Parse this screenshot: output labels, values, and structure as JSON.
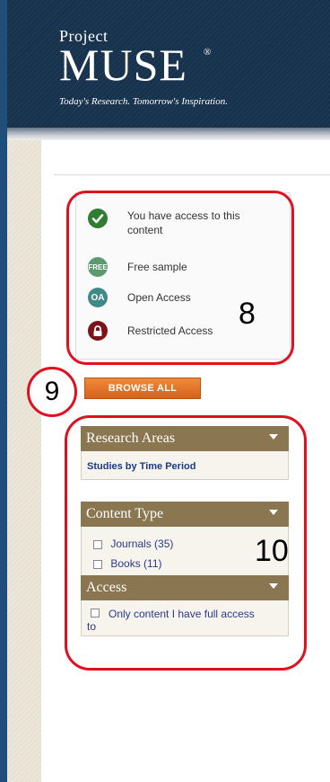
{
  "header": {
    "logo_project": "Project",
    "logo_muse": "MUSE",
    "logo_reg": "®",
    "tagline": "Today's Research. Tomorrow's Inspiration."
  },
  "legend": {
    "items": [
      {
        "label": "You have access to this content",
        "icon": "check-icon",
        "color": "#2e7d32",
        "glyph": "✔"
      },
      {
        "label": "Free sample",
        "icon": "free-icon",
        "color": "#5a9a6e",
        "glyph": "FREE"
      },
      {
        "label": "Open Access",
        "icon": "oa-icon",
        "color": "#3f8a86",
        "glyph": "OA"
      },
      {
        "label": "Restricted Access",
        "icon": "lock-icon",
        "color": "#7a1418",
        "glyph": ""
      }
    ]
  },
  "annotations": {
    "legend_number": "8",
    "browse_number": "9",
    "facets_number": "10",
    "color": "#e01020"
  },
  "browse_all": "BROWSE ALL",
  "facets": {
    "research_areas": {
      "title": "Research Areas",
      "link": "Studies by Time Period"
    },
    "content_type": {
      "title": "Content Type",
      "options": [
        {
          "label": "Journals",
          "count": "(35)"
        },
        {
          "label": "Books",
          "count": "(11)"
        }
      ]
    },
    "access": {
      "title": "Access",
      "option": "Only content I have full access to"
    }
  }
}
